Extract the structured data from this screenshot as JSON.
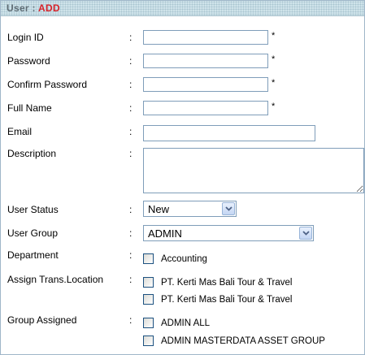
{
  "header": {
    "prefix": "User : ",
    "action": "ADD"
  },
  "fields": {
    "login_id": {
      "label": "Login ID",
      "colon": ":",
      "value": "",
      "required_mark": "*"
    },
    "password": {
      "label": "Password",
      "colon": ":",
      "value": "",
      "required_mark": "*"
    },
    "confirm_password": {
      "label": "Confirm Password",
      "colon": ":",
      "value": "",
      "required_mark": "*"
    },
    "full_name": {
      "label": "Full Name",
      "colon": ":",
      "value": "",
      "required_mark": "*"
    },
    "email": {
      "label": "Email",
      "colon": ":",
      "value": ""
    },
    "description": {
      "label": "Description",
      "colon": ":",
      "value": ""
    },
    "user_status": {
      "label": "User Status",
      "colon": ":",
      "selected": "New"
    },
    "user_group": {
      "label": "User Group",
      "colon": ":",
      "selected": "ADMIN"
    },
    "department": {
      "label": "Department",
      "colon": ":",
      "options": [
        "Accounting"
      ]
    },
    "assign_location": {
      "label": "Assign Trans.Location",
      "colon": ":",
      "options": [
        "PT. Kerti Mas Bali Tour & Travel",
        "PT. Kerti Mas Bali Tour & Travel"
      ]
    },
    "group_assigned": {
      "label": "Group Assigned",
      "colon": ":",
      "options": [
        "ADMIN ALL",
        "ADMIN MASTERDATA ASSET GROUP"
      ]
    }
  },
  "icons": {
    "dropdown": "chevron-down-icon",
    "checkbox": "checkbox-unchecked-icon"
  },
  "colors": {
    "header_bg": "#cfe3ea",
    "header_text": "#5e6c74",
    "action_text": "#d8232a",
    "input_border": "#7f9db9"
  }
}
